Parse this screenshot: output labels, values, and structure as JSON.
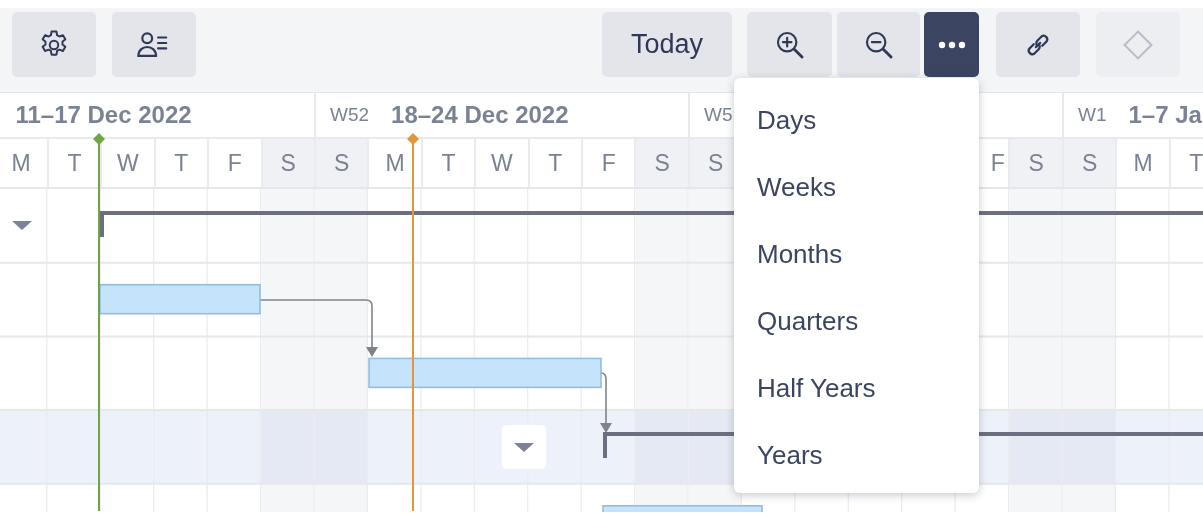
{
  "toolbar": {
    "buttons": [
      {
        "kind": "settings",
        "active": false,
        "disabled": false
      },
      {
        "kind": "people",
        "active": false,
        "disabled": false
      },
      {
        "kind": "today",
        "label": "Today",
        "active": false,
        "disabled": false
      },
      {
        "kind": "zoom-in",
        "active": false,
        "disabled": false
      },
      {
        "kind": "zoom-out",
        "active": false,
        "disabled": false
      },
      {
        "kind": "more",
        "active": true,
        "disabled": false
      },
      {
        "kind": "link",
        "active": false,
        "disabled": false
      },
      {
        "kind": "milestone",
        "active": false,
        "disabled": true
      }
    ]
  },
  "timeline": {
    "weeks": [
      {
        "range": "11–17 Dec 2022"
      },
      {
        "number": "W52",
        "range": "18–24 Dec 2022"
      },
      {
        "number": "W5"
      },
      {
        "number": "W1",
        "range": "1–7 Ja"
      }
    ],
    "days": [
      {
        "label": "M",
        "weekend": false
      },
      {
        "label": "T",
        "weekend": false
      },
      {
        "label": "W",
        "weekend": false
      },
      {
        "label": "T",
        "weekend": false
      },
      {
        "label": "F",
        "weekend": false
      },
      {
        "label": "S",
        "weekend": true
      },
      {
        "label": "S",
        "weekend": true
      },
      {
        "label": "M",
        "weekend": false
      },
      {
        "label": "T",
        "weekend": false
      },
      {
        "label": "W",
        "weekend": false
      },
      {
        "label": "T",
        "weekend": false
      },
      {
        "label": "F",
        "weekend": false
      },
      {
        "label": "S",
        "weekend": true
      },
      {
        "label": "S",
        "weekend": true
      },
      {
        "label": "F",
        "weekend": false
      },
      {
        "label": "S",
        "weekend": true
      },
      {
        "label": "S",
        "weekend": true
      },
      {
        "label": "M",
        "weekend": false
      },
      {
        "label": "T",
        "weekend": false
      }
    ],
    "markers": [
      {
        "color": "#6ea646"
      },
      {
        "color": "#e0963a"
      }
    ],
    "rows": [
      {
        "kind": "summary",
        "expanded": true,
        "highlighted": false
      },
      {
        "kind": "task",
        "highlighted": false
      },
      {
        "kind": "task",
        "highlighted": false
      },
      {
        "kind": "summary",
        "expanded": true,
        "highlighted": true
      },
      {
        "kind": "task",
        "highlighted": false
      }
    ]
  },
  "menu": {
    "items": [
      {
        "label": "Days"
      },
      {
        "label": "Weeks"
      },
      {
        "label": "Months"
      },
      {
        "label": "Quarters"
      },
      {
        "label": "Half Years"
      },
      {
        "label": "Years"
      }
    ]
  }
}
